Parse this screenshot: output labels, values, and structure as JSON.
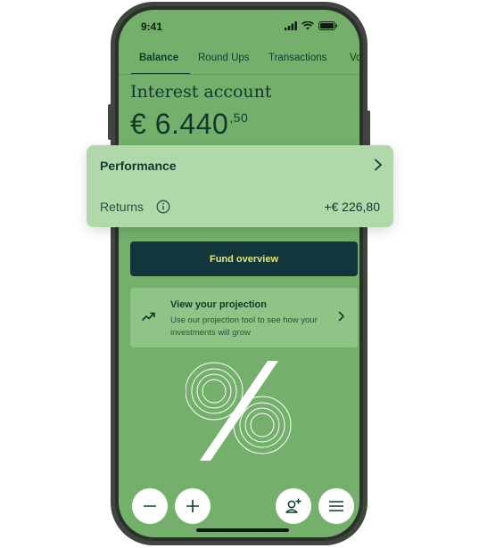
{
  "status_bar": {
    "time": "9:41"
  },
  "tabs": [
    {
      "label": "Balance",
      "active": true
    },
    {
      "label": "Round Ups",
      "active": false
    },
    {
      "label": "Transactions",
      "active": false
    },
    {
      "label": "Vou",
      "active": false
    }
  ],
  "account": {
    "title": "Interest account",
    "balance_main": "€ 6.440",
    "balance_decimals": ",50"
  },
  "performance_card": {
    "title": "Performance",
    "returns_label": "Returns",
    "returns_value": "+€ 226,80"
  },
  "fund_button": {
    "label": "Fund overview"
  },
  "projection_card": {
    "title": "View your projection",
    "description": "Use our projection tool to see how your investments will grow"
  },
  "bottom_actions": [
    {
      "icon": "minus-icon"
    },
    {
      "icon": "plus-icon"
    },
    {
      "icon": "add-user-icon"
    },
    {
      "icon": "menu-icon"
    }
  ],
  "colors": {
    "screen_bg": "#74b06c",
    "card_bg": "#b1d8a8",
    "fund_button_bg": "#12363b",
    "fund_button_text": "#e7e87a",
    "text_dark": "#12382e"
  }
}
